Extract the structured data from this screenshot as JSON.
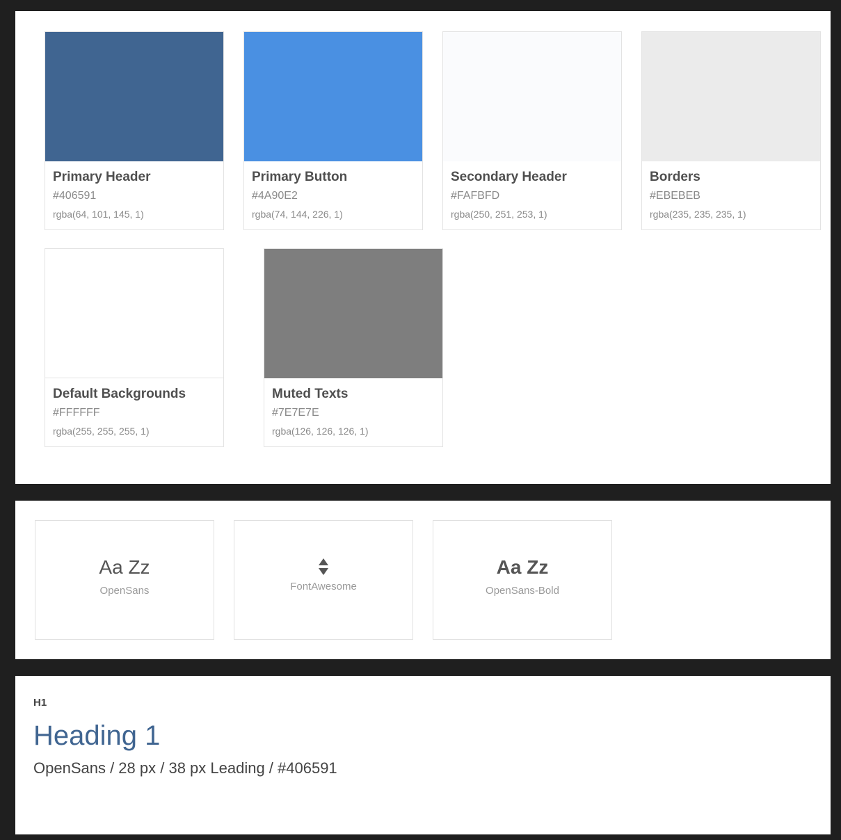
{
  "colors": [
    {
      "name": "Primary Header",
      "hex": "#406591",
      "rgba": "rgba(64, 101, 145, 1)",
      "swatch": "#406591"
    },
    {
      "name": "Primary Button",
      "hex": "#4A90E2",
      "rgba": "rgba(74, 144, 226, 1)",
      "swatch": "#4A90E2"
    },
    {
      "name": "Secondary Header",
      "hex": "#FAFBFD",
      "rgba": "rgba(250, 251, 253, 1)",
      "swatch": "#FAFBFD"
    },
    {
      "name": "Borders",
      "hex": "#EBEBEB",
      "rgba": "rgba(235, 235, 235, 1)",
      "swatch": "#EBEBEB"
    },
    {
      "name": "Default Backgrounds",
      "hex": "#FFFFFF",
      "rgba": "rgba(255, 255, 255, 1)",
      "swatch": "#FFFFFF"
    },
    {
      "name": "Muted Texts",
      "hex": "#7E7E7E",
      "rgba": "rgba(126, 126, 126, 1)",
      "swatch": "#7E7E7E"
    }
  ],
  "fonts": [
    {
      "sample": "Aa Zz",
      "label": "OpenSans"
    },
    {
      "icon": "sort-icon",
      "label": "FontAwesome"
    },
    {
      "sample": "Aa Zz",
      "label": "OpenSans-Bold"
    }
  ],
  "typography": {
    "tag": "H1",
    "heading": "Heading 1",
    "spec": "OpenSans / 28 px / 38 px Leading / #406591",
    "heading_color": "#406591"
  }
}
